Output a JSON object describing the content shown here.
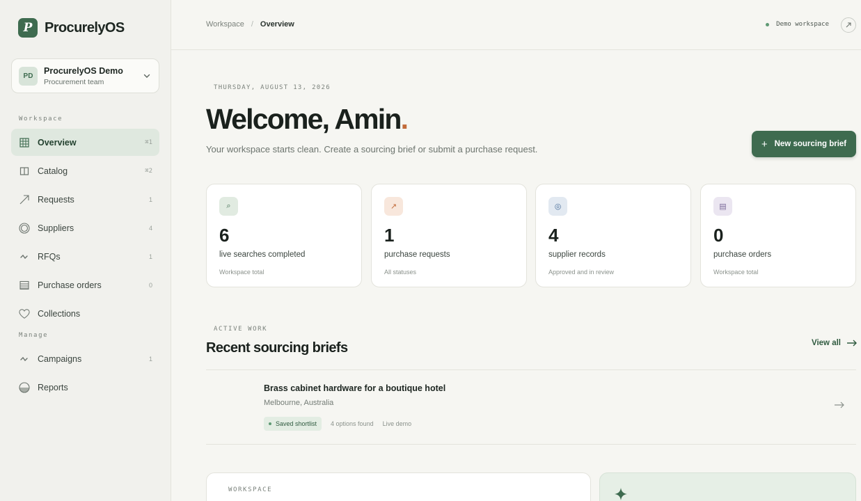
{
  "brand": {
    "logo_letter": "P",
    "name": "ProcurelyOS"
  },
  "workspace_switcher": {
    "initials": "PD",
    "name": "ProcurelyOS Demo",
    "team": "Procurement team"
  },
  "sidebar": {
    "workspace_label": "Workspace",
    "manage_label": "Manage",
    "items": [
      {
        "label": "Overview",
        "count": "⌘1",
        "icon": "grid-icon",
        "active": true
      },
      {
        "label": "Catalog",
        "count": "⌘2",
        "icon": "book-icon"
      },
      {
        "label": "Requests",
        "count": "1",
        "icon": "arrow-up-right-icon"
      },
      {
        "label": "Suppliers",
        "count": "4",
        "icon": "target-icon"
      },
      {
        "label": "RFQs",
        "count": "1",
        "icon": "pulse-icon"
      },
      {
        "label": "Purchase orders",
        "count": "0",
        "icon": "list-icon"
      },
      {
        "label": "Collections",
        "count": "",
        "icon": "heart-icon"
      }
    ],
    "manage_items": [
      {
        "label": "Campaigns",
        "count": "1",
        "icon": "pulse-icon"
      },
      {
        "label": "Reports",
        "count": "",
        "icon": "half-circle-icon"
      }
    ]
  },
  "topbar": {
    "breadcrumb_root": "Workspace",
    "breadcrumb_sep": "/",
    "breadcrumb_current": "Overview",
    "demo_label": "Demo workspace"
  },
  "hero": {
    "date": "THURSDAY, AUGUST 13, 2026",
    "welcome": "Welcome, Amin",
    "welcome_dot": ".",
    "subtitle": "Your workspace starts clean. Create a sourcing brief or submit a purchase request.",
    "new_brief_plus": "+",
    "new_brief_label": "New sourcing brief"
  },
  "stats": [
    {
      "value": "6",
      "label": "live searches completed",
      "sub": "Workspace total",
      "icon": "search-icon",
      "icon_glyph": "⌕",
      "color": "#3e6b4f",
      "bg": "#e1ebe1"
    },
    {
      "value": "1",
      "label": "purchase requests",
      "sub": "All statuses",
      "icon": "arrow-up-right-icon",
      "icon_glyph": "↗",
      "color": "#c26b3a",
      "bg": "#f8e7dc"
    },
    {
      "value": "4",
      "label": "supplier records",
      "sub": "Approved and in review",
      "icon": "target-icon",
      "icon_glyph": "◎",
      "color": "#4a6f9a",
      "bg": "#e2e9f1"
    },
    {
      "value": "0",
      "label": "purchase orders",
      "sub": "Workspace total",
      "icon": "list-icon",
      "icon_glyph": "▤",
      "color": "#7b6a9a",
      "bg": "#ebe6f1"
    }
  ],
  "active_work": {
    "label": "ACTIVE WORK",
    "title": "Recent sourcing briefs",
    "view_all": "View all",
    "briefs": [
      {
        "title": "Brass cabinet hardware for a boutique hotel",
        "location": "Melbourne, Australia",
        "status": "Saved shortlist",
        "options": "4 options found",
        "mode": "Live demo"
      }
    ]
  },
  "bottom": {
    "workspace_label": "WORKSPACE"
  },
  "colors": {
    "accent": "#3e6b4f",
    "dot": "#c26b3a",
    "background": "#f6f6f2"
  }
}
